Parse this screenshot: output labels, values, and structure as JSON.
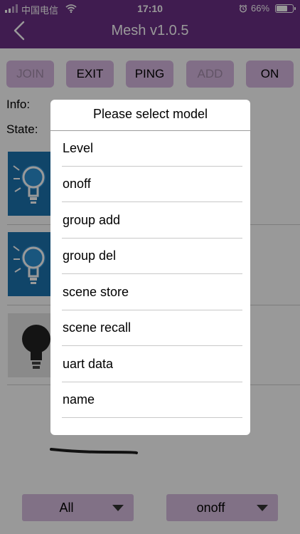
{
  "status_bar": {
    "carrier": "中国电信",
    "time": "17:10",
    "battery": "66%"
  },
  "header": {
    "title": "Mesh v1.0.5",
    "color": "#6b2f86"
  },
  "toolbar": {
    "join": "JOIN",
    "exit": "EXIT",
    "ping": "PING",
    "add": "ADD",
    "on": "ON"
  },
  "info": {
    "info_label": "Info:",
    "state_label": "State:"
  },
  "dialog": {
    "title": "Please select model",
    "options": [
      "Level",
      "onoff",
      "group add",
      "group del",
      "scene store",
      "scene recall",
      "uart data",
      "name"
    ]
  },
  "bottom": {
    "left_select": "All",
    "right_select": "onoff"
  },
  "colors": {
    "accent": "#6b2f86",
    "button": "#d7b8e1"
  }
}
